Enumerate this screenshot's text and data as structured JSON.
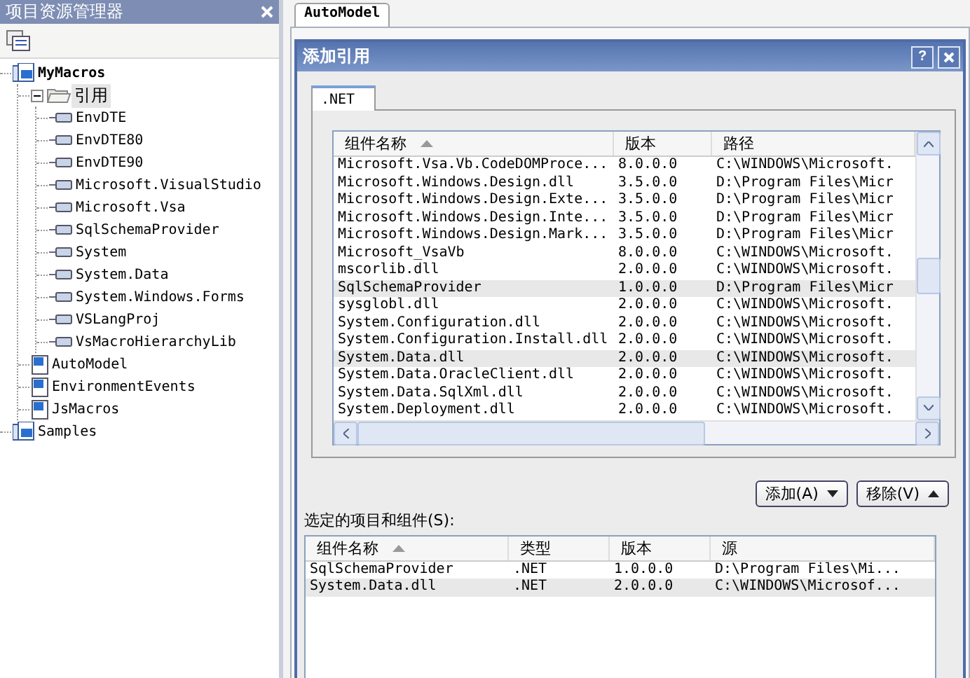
{
  "explorer": {
    "title": "项目资源管理器",
    "tree": [
      {
        "label": "MyMacros",
        "kind": "project",
        "bold": true,
        "children": [
          {
            "label": "引用",
            "kind": "folder",
            "expanded": true,
            "selected": true,
            "children": [
              {
                "label": "EnvDTE",
                "kind": "reference"
              },
              {
                "label": "EnvDTE80",
                "kind": "reference"
              },
              {
                "label": "EnvDTE90",
                "kind": "reference"
              },
              {
                "label": "Microsoft.VisualStudio",
                "kind": "reference"
              },
              {
                "label": "Microsoft.Vsa",
                "kind": "reference"
              },
              {
                "label": "SqlSchemaProvider",
                "kind": "reference"
              },
              {
                "label": "System",
                "kind": "reference"
              },
              {
                "label": "System.Data",
                "kind": "reference"
              },
              {
                "label": "System.Windows.Forms",
                "kind": "reference"
              },
              {
                "label": "VSLangProj",
                "kind": "reference"
              },
              {
                "label": "VsMacroHierarchyLib",
                "kind": "reference"
              }
            ]
          },
          {
            "label": "AutoModel",
            "kind": "module"
          },
          {
            "label": "EnvironmentEvents",
            "kind": "module"
          },
          {
            "label": "JsMacros",
            "kind": "module"
          }
        ]
      },
      {
        "label": "Samples",
        "kind": "project"
      }
    ]
  },
  "editor_tabs": [
    {
      "label": "AutoModel",
      "selected": true
    }
  ],
  "dialog": {
    "title": "添加引用",
    "help": "?",
    "tabs": [
      {
        "label": ".NET",
        "selected": true
      }
    ],
    "components": {
      "columns": [
        "组件名称",
        "版本",
        "路径"
      ],
      "rows": [
        {
          "cells": [
            "Microsoft.Vsa.Vb.CodeDOMProce...",
            "8.0.0.0",
            "C:\\WINDOWS\\Microsoft."
          ],
          "selected": false
        },
        {
          "cells": [
            "Microsoft.Windows.Design.dll",
            "3.5.0.0",
            "D:\\Program Files\\Micr"
          ],
          "selected": false
        },
        {
          "cells": [
            "Microsoft.Windows.Design.Exte...",
            "3.5.0.0",
            "D:\\Program Files\\Micr"
          ],
          "selected": false
        },
        {
          "cells": [
            "Microsoft.Windows.Design.Inte...",
            "3.5.0.0",
            "D:\\Program Files\\Micr"
          ],
          "selected": false
        },
        {
          "cells": [
            "Microsoft.Windows.Design.Mark...",
            "3.5.0.0",
            "D:\\Program Files\\Micr"
          ],
          "selected": false
        },
        {
          "cells": [
            "Microsoft_VsaVb",
            "8.0.0.0",
            "C:\\WINDOWS\\Microsoft."
          ],
          "selected": false
        },
        {
          "cells": [
            "mscorlib.dll",
            "2.0.0.0",
            "C:\\WINDOWS\\Microsoft."
          ],
          "selected": false
        },
        {
          "cells": [
            "SqlSchemaProvider",
            "1.0.0.0",
            "D:\\Program Files\\Micr"
          ],
          "selected": true
        },
        {
          "cells": [
            "sysglobl.dll",
            "2.0.0.0",
            "C:\\WINDOWS\\Microsoft."
          ],
          "selected": false
        },
        {
          "cells": [
            "System.Configuration.dll",
            "2.0.0.0",
            "C:\\WINDOWS\\Microsoft."
          ],
          "selected": false
        },
        {
          "cells": [
            "System.Configuration.Install.dll",
            "2.0.0.0",
            "C:\\WINDOWS\\Microsoft."
          ],
          "selected": false
        },
        {
          "cells": [
            "System.Data.dll",
            "2.0.0.0",
            "C:\\WINDOWS\\Microsoft."
          ],
          "selected": true
        },
        {
          "cells": [
            "System.Data.OracleClient.dll",
            "2.0.0.0",
            "C:\\WINDOWS\\Microsoft."
          ],
          "selected": false
        },
        {
          "cells": [
            "System.Data.SqlXml.dll",
            "2.0.0.0",
            "C:\\WINDOWS\\Microsoft."
          ],
          "selected": false
        },
        {
          "cells": [
            "System.Deployment.dll",
            "2.0.0.0",
            "C:\\WINDOWS\\Microsoft."
          ],
          "selected": false
        }
      ]
    },
    "buttons": [
      {
        "label": "添加(A)",
        "kind": "down"
      },
      {
        "label": "移除(V)",
        "kind": "up"
      }
    ],
    "selected_label": "选定的项目和组件(S):",
    "selected_components": {
      "columns": [
        "组件名称",
        "类型",
        "版本",
        "源"
      ],
      "rows": [
        {
          "cells": [
            "SqlSchemaProvider",
            ".NET",
            "1.0.0.0",
            "D:\\Program Files\\Mi..."
          ],
          "selected": false
        },
        {
          "cells": [
            "System.Data.dll",
            ".NET",
            "2.0.0.0",
            "C:\\WINDOWS\\Microsof..."
          ],
          "selected": true
        }
      ]
    }
  }
}
